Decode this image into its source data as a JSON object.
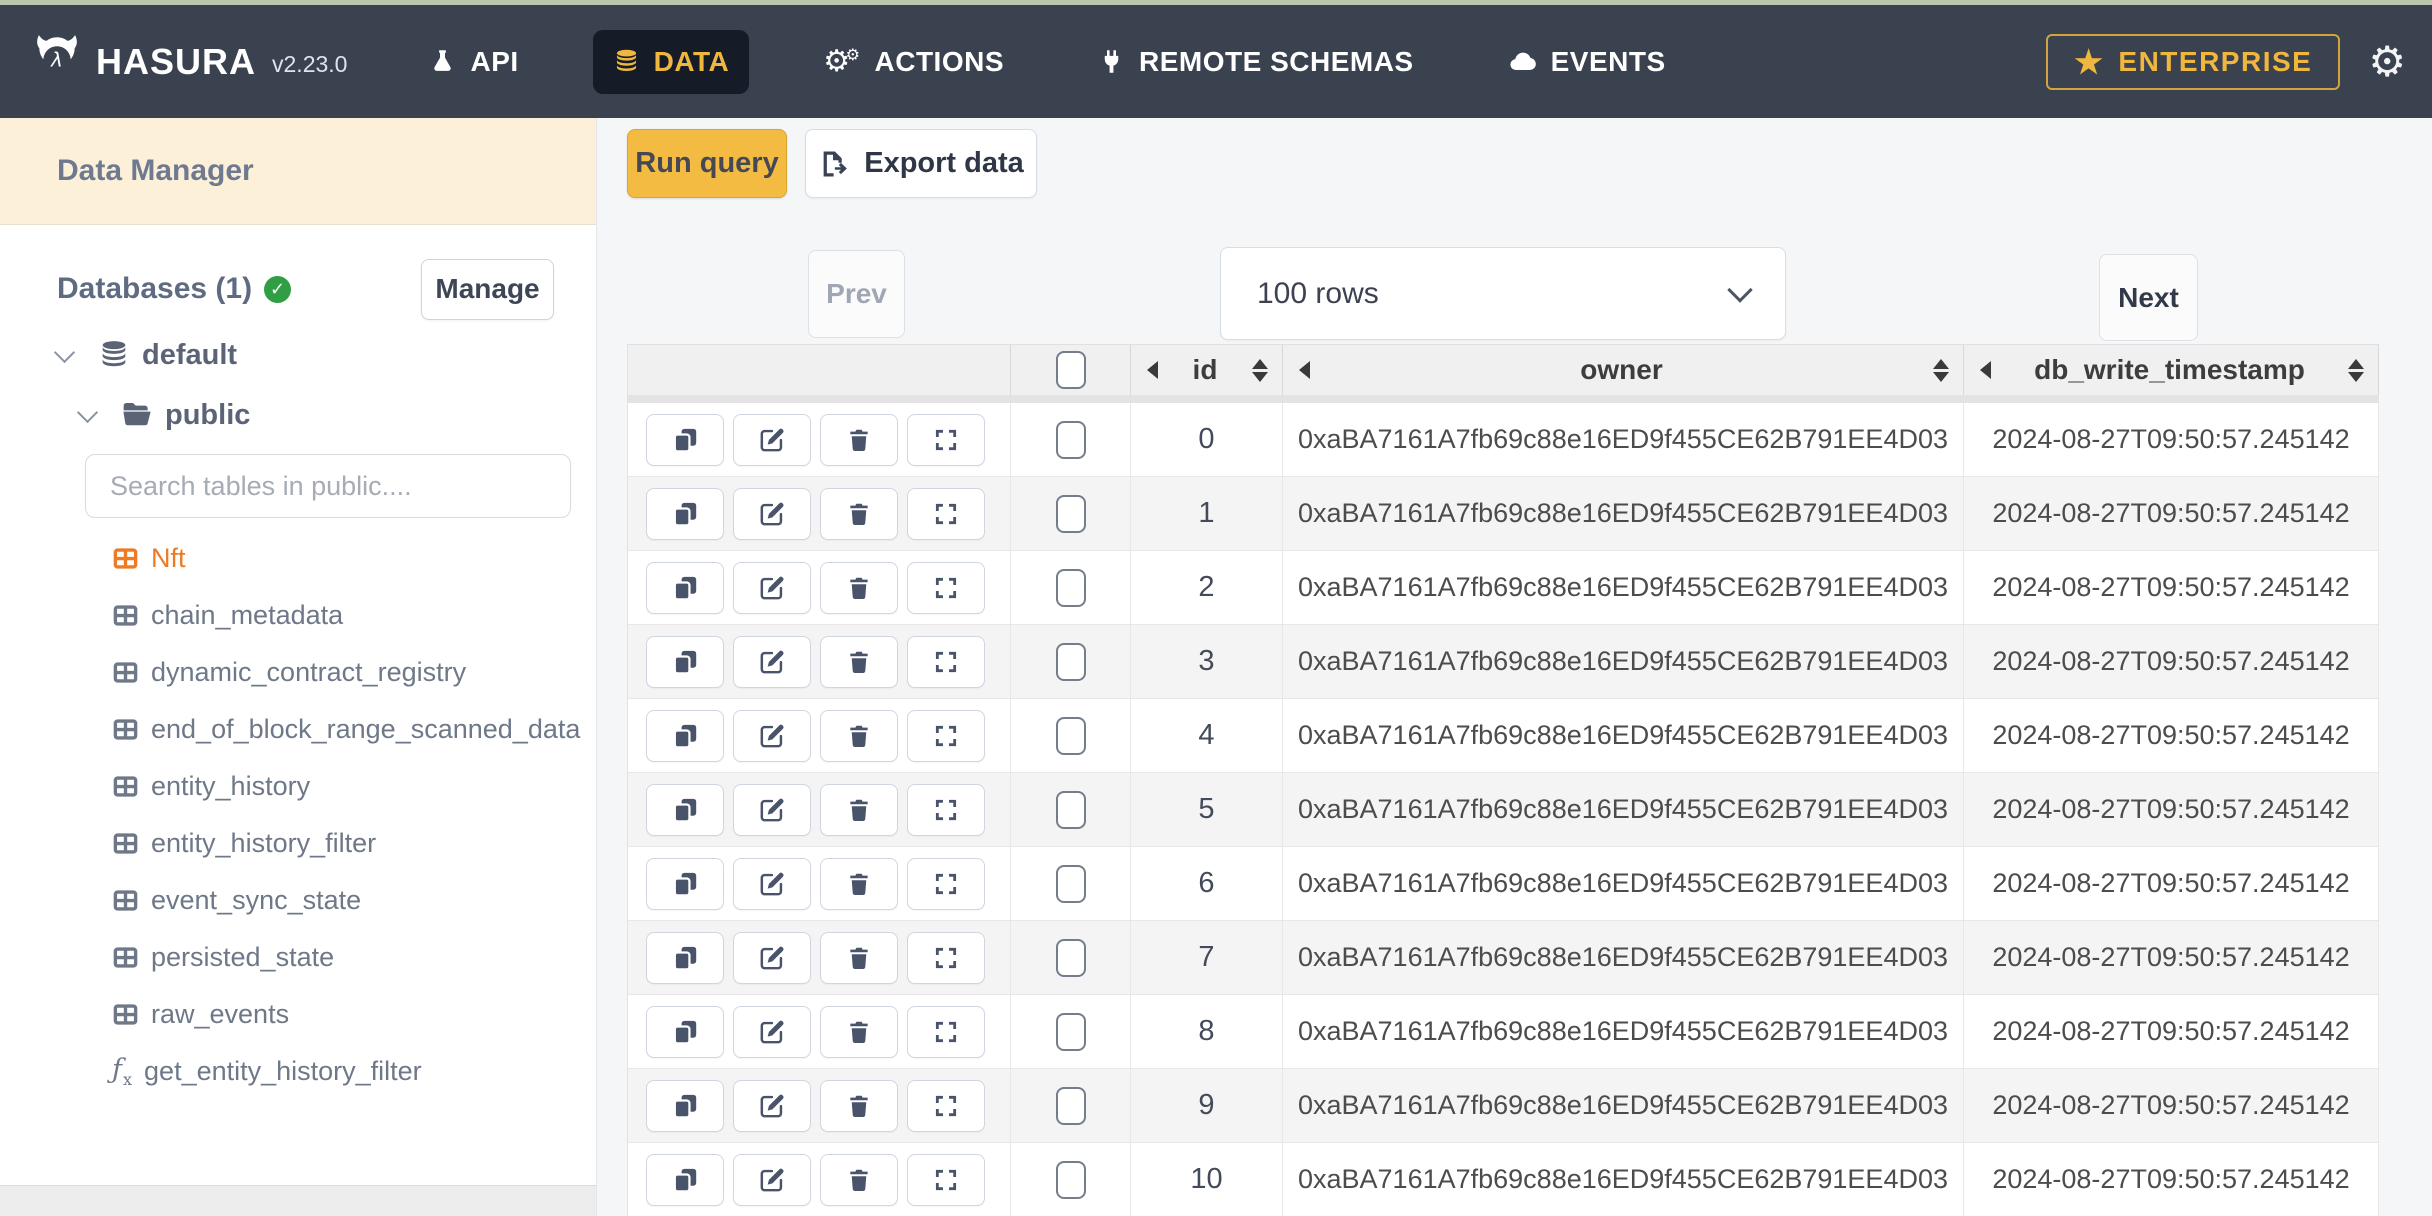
{
  "colors": {
    "top_strip": "#b9c7ad",
    "nav_bg": "#3a4250",
    "nav_active_bg": "#151b27",
    "accent_yellow": "#f0b73e",
    "brand_orange": "#ee7b24",
    "success_green": "#2f9e44",
    "run_query_bg": "#f3bb41",
    "cream": "#fcf1d8"
  },
  "navbar": {
    "brand": "HASURA",
    "version": "v2.23.0",
    "items": [
      {
        "label": "API",
        "icon": "flask-icon",
        "active": false
      },
      {
        "label": "DATA",
        "icon": "database-icon",
        "active": true
      },
      {
        "label": "ACTIONS",
        "icon": "gears-icon",
        "active": false
      },
      {
        "label": "REMOTE SCHEMAS",
        "icon": "plug-icon",
        "active": false
      },
      {
        "label": "EVENTS",
        "icon": "cloud-icon",
        "active": false
      }
    ],
    "enterprise_label": "ENTERPRISE",
    "star_glyph": "★",
    "gear_glyph": "⚙"
  },
  "sidebar": {
    "title": "Data Manager",
    "databases_label": "Databases (1)",
    "manage_label": "Manage",
    "tree": {
      "database": "default",
      "schema": "public"
    },
    "search_placeholder": "Search tables in public....",
    "tables": [
      {
        "name": "Nft",
        "type": "table",
        "active": true
      },
      {
        "name": "chain_metadata",
        "type": "table",
        "active": false
      },
      {
        "name": "dynamic_contract_registry",
        "type": "table",
        "active": false
      },
      {
        "name": "end_of_block_range_scanned_data",
        "type": "table",
        "active": false
      },
      {
        "name": "entity_history",
        "type": "table",
        "active": false
      },
      {
        "name": "entity_history_filter",
        "type": "table",
        "active": false
      },
      {
        "name": "event_sync_state",
        "type": "table",
        "active": false
      },
      {
        "name": "persisted_state",
        "type": "table",
        "active": false
      },
      {
        "name": "raw_events",
        "type": "table",
        "active": false
      },
      {
        "name": "get_entity_history_filter",
        "type": "function",
        "active": false
      }
    ]
  },
  "toolbar": {
    "run_query_label": "Run query",
    "export_data_label": "Export data"
  },
  "pagination": {
    "prev_label": "Prev",
    "rows_select_value": "100 rows",
    "next_label": "Next"
  },
  "table": {
    "columns": [
      "id",
      "owner",
      "db_write_timestamp"
    ],
    "rows": [
      {
        "id": "0",
        "owner": "0xaBA7161A7fb69c88e16ED9f455CE62B791EE4D03",
        "db_write_timestamp": "2024-08-27T09:50:57.245142"
      },
      {
        "id": "1",
        "owner": "0xaBA7161A7fb69c88e16ED9f455CE62B791EE4D03",
        "db_write_timestamp": "2024-08-27T09:50:57.245142"
      },
      {
        "id": "2",
        "owner": "0xaBA7161A7fb69c88e16ED9f455CE62B791EE4D03",
        "db_write_timestamp": "2024-08-27T09:50:57.245142"
      },
      {
        "id": "3",
        "owner": "0xaBA7161A7fb69c88e16ED9f455CE62B791EE4D03",
        "db_write_timestamp": "2024-08-27T09:50:57.245142"
      },
      {
        "id": "4",
        "owner": "0xaBA7161A7fb69c88e16ED9f455CE62B791EE4D03",
        "db_write_timestamp": "2024-08-27T09:50:57.245142"
      },
      {
        "id": "5",
        "owner": "0xaBA7161A7fb69c88e16ED9f455CE62B791EE4D03",
        "db_write_timestamp": "2024-08-27T09:50:57.245142"
      },
      {
        "id": "6",
        "owner": "0xaBA7161A7fb69c88e16ED9f455CE62B791EE4D03",
        "db_write_timestamp": "2024-08-27T09:50:57.245142"
      },
      {
        "id": "7",
        "owner": "0xaBA7161A7fb69c88e16ED9f455CE62B791EE4D03",
        "db_write_timestamp": "2024-08-27T09:50:57.245142"
      },
      {
        "id": "8",
        "owner": "0xaBA7161A7fb69c88e16ED9f455CE62B791EE4D03",
        "db_write_timestamp": "2024-08-27T09:50:57.245142"
      },
      {
        "id": "9",
        "owner": "0xaBA7161A7fb69c88e16ED9f455CE62B791EE4D03",
        "db_write_timestamp": "2024-08-27T09:50:57.245142"
      },
      {
        "id": "10",
        "owner": "0xaBA7161A7fb69c88e16ED9f455CE62B791EE4D03",
        "db_write_timestamp": "2024-08-27T09:50:57.245142"
      }
    ]
  }
}
